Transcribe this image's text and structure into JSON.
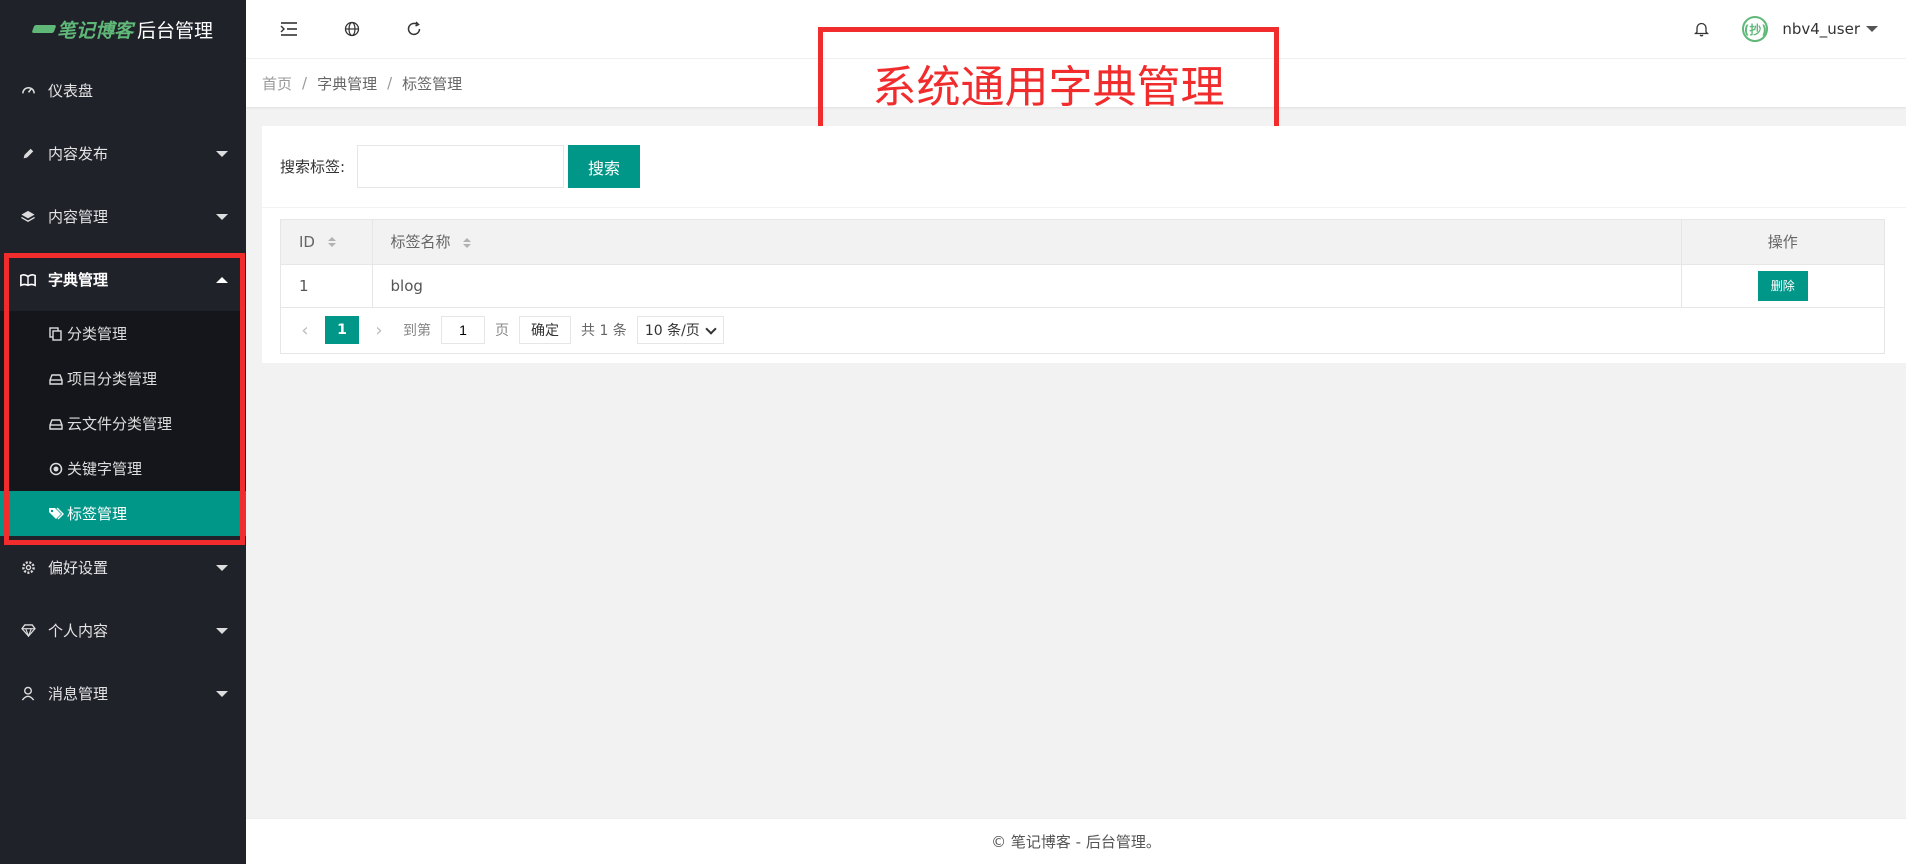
{
  "logo": {
    "brand": "笔记博客",
    "suffix": "后台管理"
  },
  "sidebar": {
    "items": [
      {
        "label": "仪表盘",
        "icon": "dashboard-icon"
      },
      {
        "label": "内容发布",
        "icon": "pencil-icon"
      },
      {
        "label": "内容管理",
        "icon": "layers-icon"
      },
      {
        "label": "字典管理",
        "icon": "book-icon"
      },
      {
        "label": "偏好设置",
        "icon": "gear-icon"
      },
      {
        "label": "个人内容",
        "icon": "diamond-icon"
      },
      {
        "label": "消息管理",
        "icon": "user-icon"
      }
    ],
    "submenu": [
      {
        "label": "分类管理",
        "icon": "copy-icon"
      },
      {
        "label": "项目分类管理",
        "icon": "drive-icon"
      },
      {
        "label": "云文件分类管理",
        "icon": "drive-icon"
      },
      {
        "label": "关键字管理",
        "icon": "target-icon"
      },
      {
        "label": "标签管理",
        "icon": "tags-icon"
      }
    ]
  },
  "header": {
    "username": "nbv4_user",
    "avatar_text": "(抄)"
  },
  "breadcrumb": [
    "首页",
    "字典管理",
    "标签管理"
  ],
  "annotation": "系统通用字典管理",
  "search": {
    "label": "搜索标签:",
    "value": "",
    "button": "搜索"
  },
  "table": {
    "columns": [
      "ID",
      "标签名称",
      "操作"
    ],
    "rows": [
      {
        "id": "1",
        "name": "blog",
        "action": "删除"
      }
    ]
  },
  "pager": {
    "current": "1",
    "goto_label": "到第",
    "goto_value": "1",
    "page_unit": "页",
    "confirm": "确定",
    "total": "共 1 条",
    "page_size": "10 条/页"
  },
  "footer": "© 笔记博客 - 后台管理。",
  "colors": {
    "accent": "#009688",
    "sidebar_bg": "#20222a",
    "annotation": "#f02c2c",
    "brand": "#5fb878"
  }
}
